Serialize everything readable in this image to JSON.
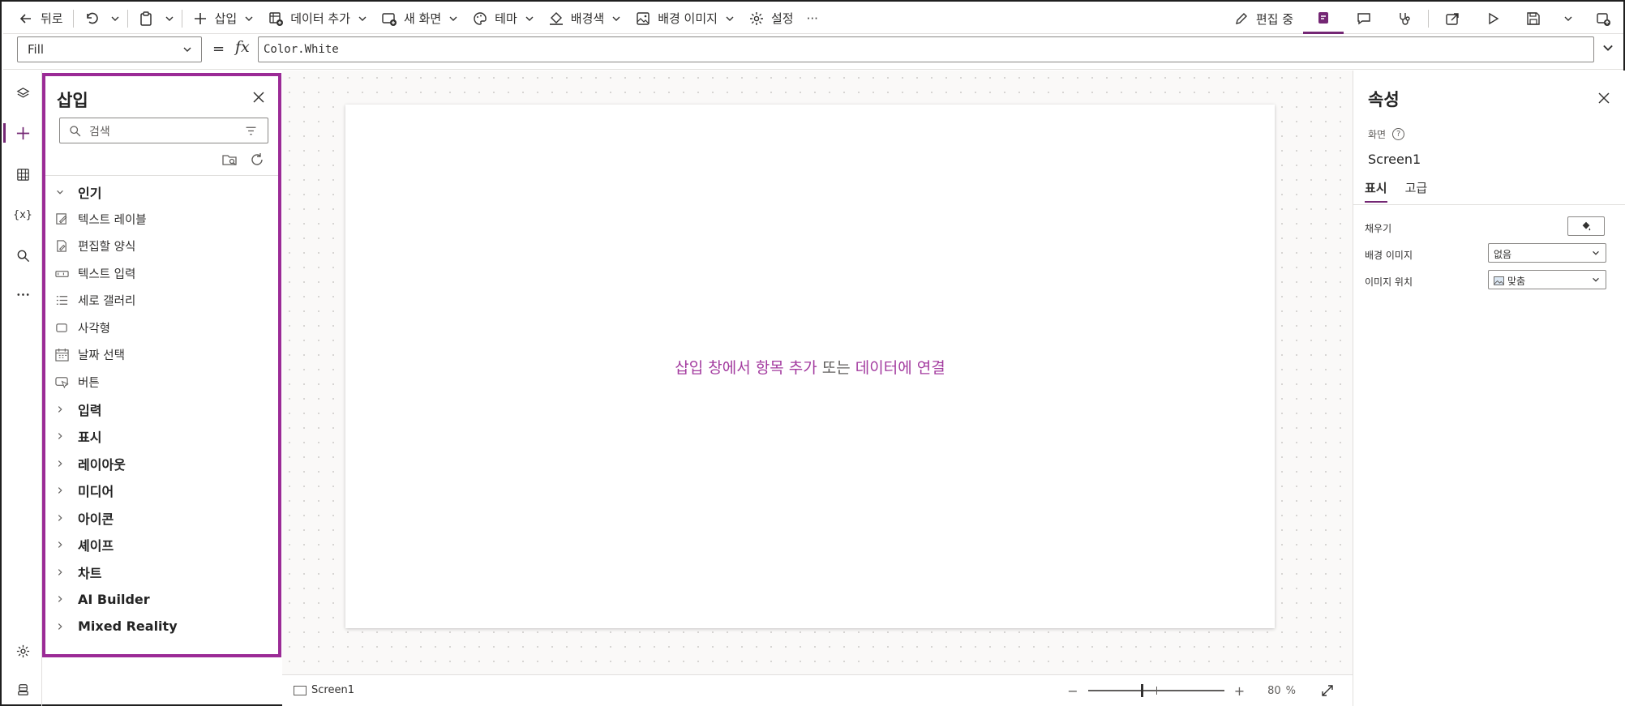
{
  "toolbar": {
    "back": "뒤로",
    "insert": "삽입",
    "add_data": "데이터 추가",
    "new_screen": "새 화면",
    "theme": "테마",
    "background_color": "배경색",
    "background_image": "배경 이미지",
    "settings": "설정",
    "more": "···",
    "editing": "편집 중"
  },
  "formula_bar": {
    "property": "Fill",
    "equals": "=",
    "fx": "fx",
    "formula": "Color.White"
  },
  "insert_pane": {
    "title": "삽입",
    "search_placeholder": "검색",
    "popular_group": "인기",
    "popular_items": [
      {
        "label": "텍스트 레이블",
        "icon": "text-label-icon"
      },
      {
        "label": "편집할 양식",
        "icon": "edit-form-icon"
      },
      {
        "label": "텍스트 입력",
        "icon": "text-input-icon"
      },
      {
        "label": "세로 갤러리",
        "icon": "vertical-gallery-icon"
      },
      {
        "label": "사각형",
        "icon": "rectangle-icon"
      },
      {
        "label": "날짜 선택",
        "icon": "calendar-icon"
      },
      {
        "label": "버튼",
        "icon": "button-icon"
      }
    ],
    "groups": [
      "입력",
      "표시",
      "레이아웃",
      "미디어",
      "아이콘",
      "셰이프",
      "차트",
      "AI Builder",
      "Mixed Reality"
    ]
  },
  "canvas": {
    "hint_link1": "삽입 창에서 항목 추가",
    "hint_mid": " 또는 ",
    "hint_link2": "데이터에 연결"
  },
  "statusbar": {
    "screen_name": "Screen1",
    "zoom_minus": "−",
    "zoom_plus": "+",
    "zoom_value": "80",
    "zoom_unit": "%",
    "zoom_level": 0.8
  },
  "properties": {
    "title": "속성",
    "kind": "화면",
    "help": "?",
    "name": "Screen1",
    "tabs": [
      "표시",
      "고급"
    ],
    "fill_label": "채우기",
    "bg_image_label": "배경 이미지",
    "bg_image_value": "없음",
    "image_pos_label": "이미지 위치",
    "image_pos_value": "맞춤"
  },
  "colors": {
    "accent": "#742774",
    "pane_border": "#9b2b96",
    "hint_link": "#a33b9f"
  }
}
